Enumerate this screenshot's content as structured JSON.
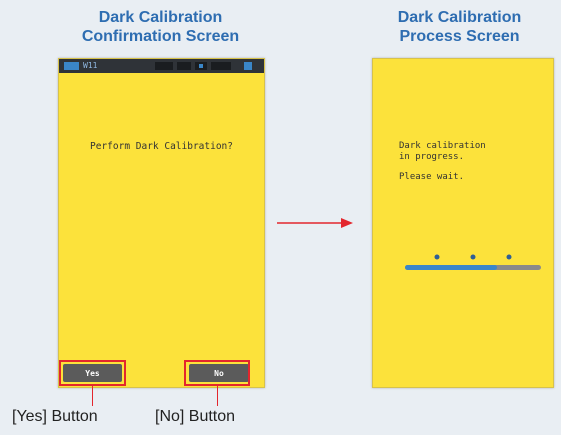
{
  "left_panel": {
    "title_line1": "Dark Calibration",
    "title_line2": "Confirmation Screen",
    "status_text": "W11",
    "prompt": "Perform Dark Calibration?",
    "yes_label": "Yes",
    "no_label": "No"
  },
  "right_panel": {
    "title_line1": "Dark Calibration",
    "title_line2": "Process Screen",
    "message_line1": "Dark calibration",
    "message_line2": "in progress.",
    "message_line3": "Please wait."
  },
  "captions": {
    "yes_caption": "[Yes] Button",
    "no_caption": "[No] Button"
  },
  "colors": {
    "screen_bg": "#fce23b",
    "heading": "#2e6db1",
    "highlight": "#e3262d",
    "button": "#5b5b5b",
    "status_bar": "#2f3338",
    "progress_fill": "#3a86c8"
  },
  "icons": [
    "battery-icon",
    "signal-icon",
    "arrow-right-icon",
    "progress-dot-icon"
  ]
}
